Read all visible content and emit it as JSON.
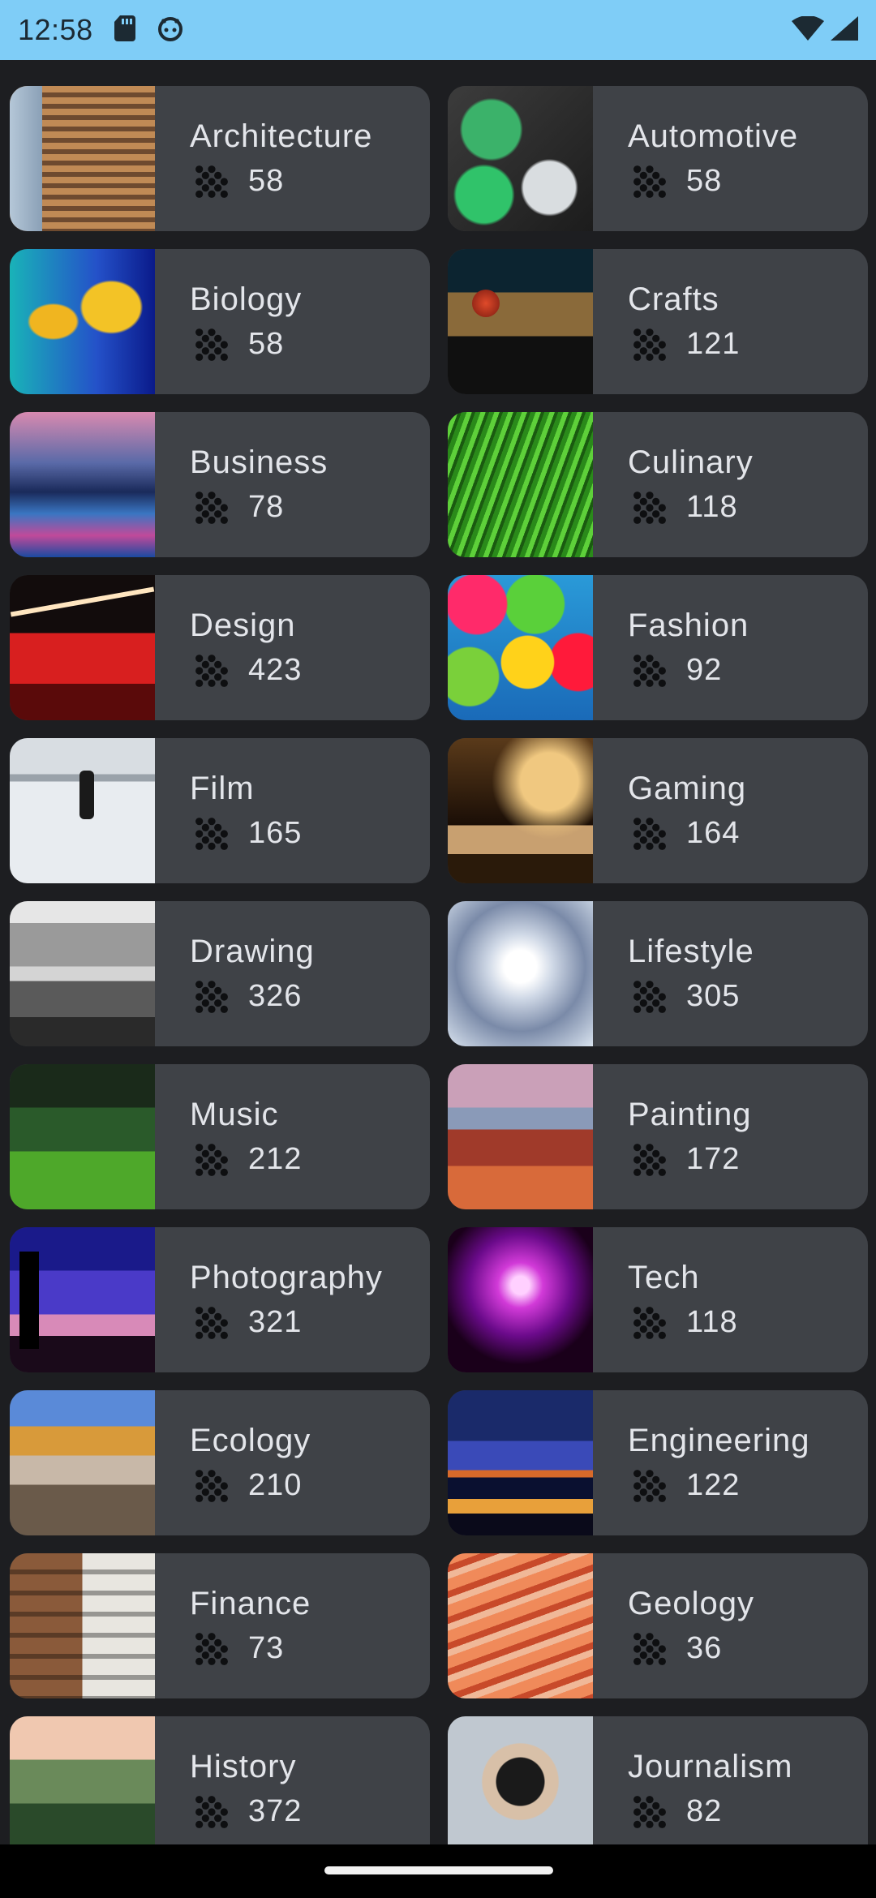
{
  "status_bar": {
    "time": "12:58",
    "icons_left": [
      "sd-card-icon",
      "android-debug-icon"
    ],
    "icons_right": [
      "wifi-icon",
      "cellular-signal-icon"
    ],
    "background": "#7fcdf7"
  },
  "categories": [
    {
      "title": "Architecture",
      "count": "58",
      "image": "architecture-thumbnail"
    },
    {
      "title": "Automotive",
      "count": "58",
      "image": "automotive-thumbnail"
    },
    {
      "title": "Biology",
      "count": "58",
      "image": "biology-thumbnail"
    },
    {
      "title": "Crafts",
      "count": "121",
      "image": "crafts-thumbnail"
    },
    {
      "title": "Business",
      "count": "78",
      "image": "business-thumbnail"
    },
    {
      "title": "Culinary",
      "count": "118",
      "image": "culinary-thumbnail"
    },
    {
      "title": "Design",
      "count": "423",
      "image": "design-thumbnail"
    },
    {
      "title": "Fashion",
      "count": "92",
      "image": "fashion-thumbnail"
    },
    {
      "title": "Film",
      "count": "165",
      "image": "film-thumbnail"
    },
    {
      "title": "Gaming",
      "count": "164",
      "image": "gaming-thumbnail"
    },
    {
      "title": "Drawing",
      "count": "326",
      "image": "drawing-thumbnail"
    },
    {
      "title": "Lifestyle",
      "count": "305",
      "image": "lifestyle-thumbnail"
    },
    {
      "title": "Music",
      "count": "212",
      "image": "music-thumbnail"
    },
    {
      "title": "Painting",
      "count": "172",
      "image": "painting-thumbnail"
    },
    {
      "title": "Photography",
      "count": "321",
      "image": "photography-thumbnail"
    },
    {
      "title": "Tech",
      "count": "118",
      "image": "tech-thumbnail"
    },
    {
      "title": "Ecology",
      "count": "210",
      "image": "ecology-thumbnail"
    },
    {
      "title": "Engineering",
      "count": "122",
      "image": "engineering-thumbnail"
    },
    {
      "title": "Finance",
      "count": "73",
      "image": "finance-thumbnail"
    },
    {
      "title": "Geology",
      "count": "36",
      "image": "geology-thumbnail"
    },
    {
      "title": "History",
      "count": "372",
      "image": "history-thumbnail"
    },
    {
      "title": "Journalism",
      "count": "82",
      "image": "journalism-thumbnail"
    }
  ],
  "count_icon": "grain-dots-icon",
  "colors": {
    "background": "#1d1e21",
    "card": "#3f4247",
    "text": "#e3e5ea"
  }
}
